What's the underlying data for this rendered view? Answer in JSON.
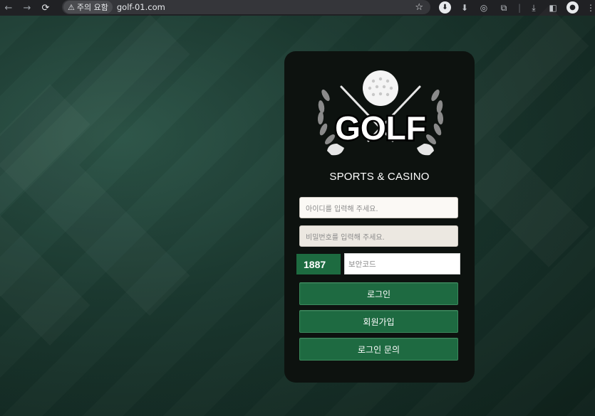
{
  "browser": {
    "back_icon": "←",
    "forward_icon": "→",
    "reload_icon": "⟳",
    "security_label": "주의 요함",
    "url": "golf-01.com",
    "star_icon": "☆"
  },
  "brand": {
    "logo_text": "GOLF",
    "subtitle": "SPORTS & CASINO"
  },
  "form": {
    "username_placeholder": "아이디를 입력해 주세요.",
    "password_placeholder": "비밀번호를 입력해 주세요.",
    "captcha_code": "1887",
    "captcha_placeholder": "보안코드"
  },
  "buttons": {
    "login": "로그인",
    "signup": "회원가입",
    "login_inquiry": "로그인 문의"
  },
  "colors": {
    "accent_green": "#1e6a41",
    "card_bg": "#0d120f"
  }
}
